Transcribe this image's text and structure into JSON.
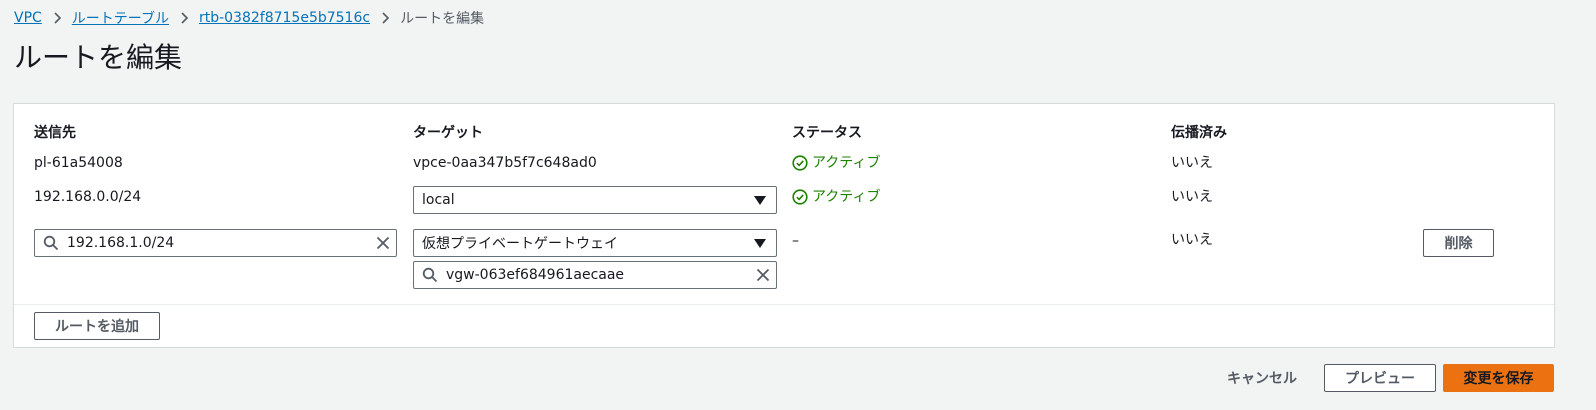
{
  "breadcrumb": {
    "items": [
      "VPC",
      "ルートテーブル",
      "rtb-0382f8715e5b7516c"
    ],
    "current": "ルートを編集"
  },
  "page_title": "ルートを編集",
  "table": {
    "headers": {
      "destination": "送信先",
      "target": "ターゲット",
      "status": "ステータス",
      "propagated": "伝播済み"
    },
    "rows": [
      {
        "destination": "pl-61a54008",
        "target": "vpce-0aa347b5f7c648ad0",
        "status": "アクティブ",
        "propagated": "いいえ"
      },
      {
        "destination": "192.168.0.0/24",
        "target": "local",
        "status": "アクティブ",
        "propagated": "いいえ"
      },
      {
        "destination": "192.168.1.0/24",
        "target": "仮想プライベートゲートウェイ",
        "target_id": "vgw-063ef684961aecaae",
        "status": "–",
        "propagated": "いいえ",
        "remove_label": "削除"
      }
    ]
  },
  "add_route_label": "ルートを追加",
  "footer": {
    "cancel_label": "キャンセル",
    "preview_label": "プレビュー",
    "save_label": "変更を保存"
  },
  "colors": {
    "link": "#0073bb",
    "status_active": "#1d8102",
    "primary": "#ec7211"
  }
}
